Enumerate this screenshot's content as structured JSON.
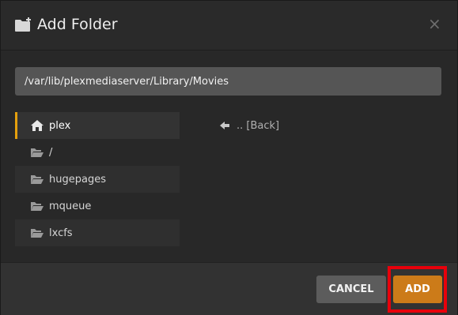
{
  "dialog": {
    "title": "Add Folder",
    "close_label": "×",
    "header_icon": "folder-plus-icon"
  },
  "path": {
    "value": "/var/lib/plexmediaserver/Library/Movies",
    "placeholder": ""
  },
  "folders": [
    {
      "label": "plex",
      "icon": "home-icon",
      "selected": true
    },
    {
      "label": "/",
      "icon": "folder-open-icon",
      "selected": false
    },
    {
      "label": "hugepages",
      "icon": "folder-open-icon",
      "selected": false
    },
    {
      "label": "mqueue",
      "icon": "folder-open-icon",
      "selected": false
    },
    {
      "label": "lxcfs",
      "icon": "folder-open-icon",
      "selected": false
    }
  ],
  "back": {
    "label": ".. [Back]",
    "icon": "arrow-left-icon"
  },
  "footer": {
    "cancel_label": "CANCEL",
    "add_label": "ADD"
  },
  "colors": {
    "accent": "#e5a00d",
    "add_button": "#cc7b19",
    "highlight": "#e8000b"
  }
}
